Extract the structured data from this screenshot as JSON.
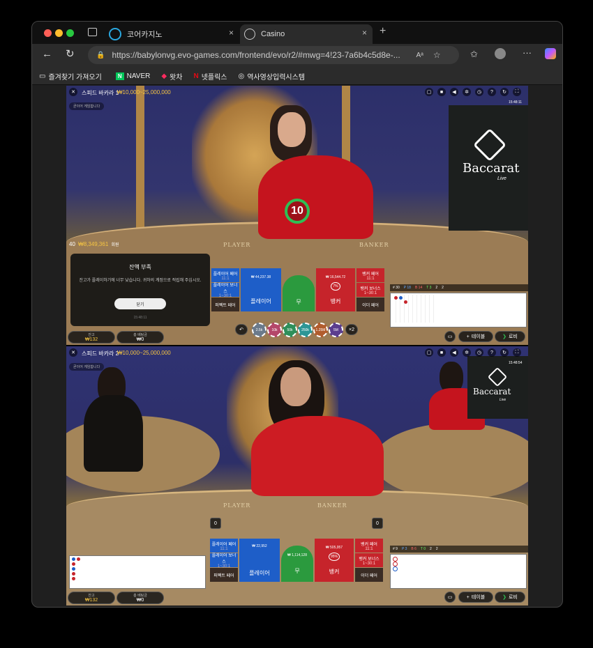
{
  "tabs": [
    {
      "title": "코어카지노",
      "close": "×"
    },
    {
      "title": "Casino",
      "close": "×"
    }
  ],
  "new_tab": "+",
  "url": "https://babylonvg.evo-games.com/frontend/evo/r2/#mwg=4!23-7a6b4c5d8e-...",
  "url_host": "babylonvg.evo-games.com",
  "bookmarks": [
    "즐겨찾기 가져오기",
    "NAVER",
    "왓차",
    "넷플릭스",
    "역사영상입력시스템"
  ],
  "game1": {
    "title": "스피드 바카라 1",
    "limits": "₩10,000~25,000,000",
    "announce": "곧이어 게임합니다",
    "timer": "10",
    "time": "15:48:11",
    "players": "40",
    "jackpot": "₩8,349,361",
    "jackpot_label": "회원",
    "brand": "Baccarat",
    "brand_sub": "Live",
    "table_player": "PLAYER",
    "table_banker": "BANKER",
    "popup": {
      "title": "잔액 부족",
      "body": "잔고가 플레이하기에 너무 낮습니다. 귀하의 계정으로 적립해 주십시오.",
      "button": "닫기",
      "time": "15:48:11"
    },
    "balance_label": "잔고",
    "balance": "₩132",
    "totalbet_label": "총 베팅금",
    "totalbet": "₩0",
    "bets": {
      "player_pair": "플레이어 페어",
      "player_pair_odds": "11:1",
      "player_bonus": "플레이어 보너스",
      "player_bonus_odds": "1~30:1",
      "perfect_pair": "퍼펙트 페어",
      "player": "플레이어",
      "player_odds": "1:1",
      "player_amount": "₩ 44,237.38",
      "player_count": "3",
      "tie": "무",
      "tie_odds": "8:1",
      "banker": "뱅커",
      "banker_odds": "0.95:1",
      "banker_amount": "₩ 16,544.72",
      "banker_count": "8",
      "banker_pct": "7%",
      "banker_pair": "뱅커 페어",
      "banker_pair_odds": "11:1",
      "banker_bonus": "뱅커 보너스",
      "banker_bonus_odds": "1~30:1",
      "either_pair": "이더 페어"
    },
    "chips": [
      "2.5k",
      "10k",
      "50k",
      "250k",
      "1.25M",
      "5M"
    ],
    "undo": "↶",
    "double": "×2",
    "table_btn": "테이블",
    "lobby_btn": "로비",
    "stats": [
      "# 30",
      "P 18",
      "B 14",
      "T 3",
      "2",
      "2"
    ]
  },
  "game2": {
    "title": "스피드 바카라 2",
    "limits": "₩10,000~25,000,000",
    "announce": "곧이어 게임합니다",
    "time": "15:48:54",
    "brand": "Baccarat",
    "brand_sub": "Live",
    "table_player": "PLAYER",
    "table_banker": "BANKER",
    "score_player": "0",
    "score_banker": "0",
    "balance_label": "잔고",
    "balance": "₩132",
    "totalbet_label": "총 베팅금",
    "totalbet": "₩0",
    "bets": {
      "player_pair": "플레이어 페어",
      "player_pair_odds": "11:1",
      "player_bonus": "플레이어 보너스",
      "player_bonus_odds": "1~30:1",
      "perfect_pair": "퍼펙트 페어",
      "player": "플레이어",
      "player_odds": "1:1",
      "player_amount": "₩ 22,952",
      "tie": "무",
      "tie_odds": "8:1",
      "tie_amount": "₩ 1,114,128",
      "banker": "뱅커",
      "banker_odds": "0.95:1",
      "banker_amount": "₩ 505,957",
      "banker_pct": "95%",
      "banker_pair": "뱅커 페어",
      "banker_pair_odds": "11:1",
      "banker_bonus": "뱅커 보너스",
      "banker_bonus_odds": "1~30:1",
      "either_pair": "이더 페어"
    },
    "table_btn": "테이블",
    "lobby_btn": "로비",
    "stats": [
      "# 9",
      "P 3",
      "B 6",
      "T 0",
      "2",
      "2"
    ]
  },
  "colors": {
    "player": "#1e5ec8",
    "banker": "#c6242b",
    "tie": "#2b9a3e"
  }
}
